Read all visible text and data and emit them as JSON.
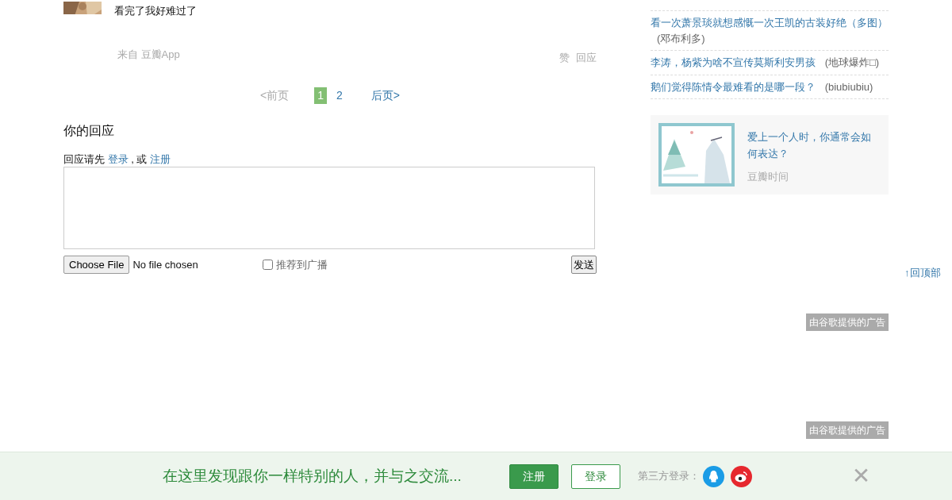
{
  "comment": {
    "text": "看完了我好难过了",
    "source": "来自 豆瓣App",
    "actions": [
      "赞",
      "回应"
    ]
  },
  "pagination": {
    "prev": {
      "label": "<前页",
      "disabled": true
    },
    "pages": [
      {
        "label": "1",
        "selected": true
      },
      {
        "label": "2",
        "selected": false
      }
    ],
    "next": {
      "label": "后页>",
      "disabled": false
    }
  },
  "reply": {
    "heading": "你的回应",
    "prompt": "回应请先",
    "login": "登录",
    "separator": ", 或",
    "register": "注册",
    "file_button": "Choose File",
    "file_status": "No file chosen",
    "share": {
      "label": "推荐到广播",
      "checked": false
    },
    "submit": "发送"
  },
  "sidebar": {
    "links": [
      {
        "title": "看一次萧景琰就想感慨一次王凯的古装好绝（多图）",
        "author": "(邓布利多)"
      },
      {
        "title": "李涛，杨紫为啥不宣传莫斯利安男孩",
        "author": "(地球爆炸□)"
      },
      {
        "title": "鹅们觉得陈情令最难看的是哪一段？",
        "author": "(biubiubiu)"
      }
    ],
    "promo": {
      "title": "爱上一个人时，你通常会如何表达？",
      "source": "豆瓣时间"
    },
    "ads": [
      "由谷歌提供的广告",
      "由谷歌提供的广告"
    ]
  },
  "back_to_top": "↑回顶部",
  "banner": {
    "text": "在这里发现跟你一样特别的人，并与之交流...",
    "register": "注册",
    "login": "登录",
    "third_party_label": "第三方登录：",
    "close": "✕"
  }
}
